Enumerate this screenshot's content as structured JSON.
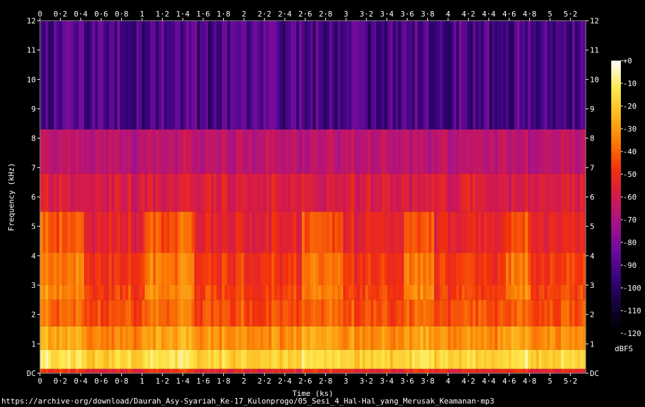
{
  "chart_data": {
    "type": "heatmap",
    "title": "",
    "xlabel": "Time (ks)",
    "ylabel": "Frequency (kHz)",
    "xlim": [
      0,
      5.35
    ],
    "ylim": [
      0,
      12
    ],
    "x_ticks": [
      "0",
      "0·2",
      "0·4",
      "0·6",
      "0·8",
      "1",
      "1·2",
      "1·4",
      "1·6",
      "1·8",
      "2",
      "2·2",
      "2·4",
      "2·6",
      "2·8",
      "3",
      "3·2",
      "3·4",
      "3·6",
      "3·8",
      "4",
      "4·2",
      "4·4",
      "4·6",
      "4·8",
      "5",
      "5·2"
    ],
    "y_ticks": [
      "DC",
      "1",
      "2",
      "3",
      "4",
      "5",
      "6",
      "7",
      "8",
      "9",
      "10",
      "11",
      "12"
    ],
    "colorbar": {
      "label": "dBFS",
      "ticks": [
        "+0",
        "-10",
        "-20",
        "-30",
        "-40",
        "-50",
        "-60",
        "-70",
        "-80",
        "-90",
        "-100",
        "-110",
        "-120"
      ],
      "range": [
        -120,
        0
      ],
      "colors": [
        "#000000",
        "#120236",
        "#37037a",
        "#6b0a9c",
        "#a3128c",
        "#d2194f",
        "#f2300c",
        "#fb7a05",
        "#fdb81c",
        "#fde94f",
        "#ffffff"
      ]
    },
    "content_cutoff_khz": 8.3,
    "speech_segments_ks": [
      [
        0.0,
        0.42
      ],
      [
        1.0,
        1.5
      ],
      [
        2.55,
        2.95
      ],
      [
        3.55,
        3.85
      ],
      [
        4.55,
        4.8
      ]
    ],
    "source_url": "https://archive·org/download/Daurah_Asy-Syariah_Ke-17_Kulonprogo/05_Sesi_4_Hal-Hal_yang_Merusak_Keamanan·mp3"
  }
}
